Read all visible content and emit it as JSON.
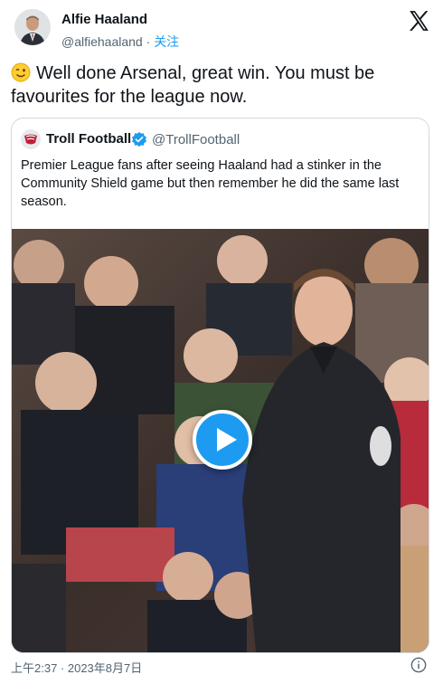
{
  "author": {
    "name": "Alfie Haaland",
    "handle": "@alfiehaaland",
    "separator": "·",
    "follow_label": "关注"
  },
  "tweet": {
    "emoji": "winking-face-icon",
    "text": "Well done Arsenal, great win. You must be favourites for the league now."
  },
  "quoted": {
    "name": "Troll Football",
    "handle": "@TrollFootball",
    "verified": true,
    "text": "Premier League fans after seeing Haaland had a stinker in the Community Shield game but then remember he did the same last season."
  },
  "media": {
    "type": "video",
    "play_icon": "play-icon"
  },
  "footer": {
    "timestamp": "上午2:37 · 2023年8月7日"
  },
  "colors": {
    "accent": "#1d9bf0",
    "text": "#0f1419",
    "secondary": "#536471",
    "border": "#cfd9de"
  }
}
